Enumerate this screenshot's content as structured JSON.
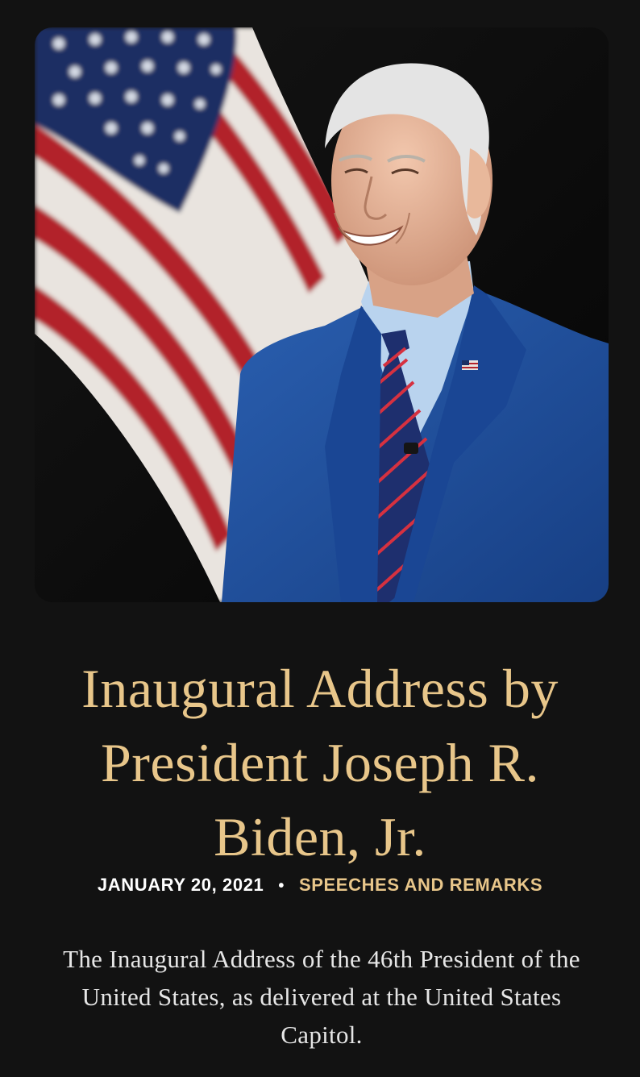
{
  "article": {
    "image": {
      "alt": "Portrait of President Joseph R. Biden, Jr. in front of an American flag",
      "colors": {
        "background": "#0b0b0b",
        "suit": "#1f4e9a",
        "shirt": "#b9d3ee",
        "flag_red": "#b2242c",
        "flag_blue": "#1b2f63"
      }
    },
    "title": "Inaugural Address by President Joseph R. Biden, Jr.",
    "date": "JANUARY 20, 2021",
    "separator": "•",
    "category": "SPEECHES AND REMARKS",
    "summary": "The Inaugural Address of the 46th President of the United States, as delivered at the United States Capitol."
  },
  "colors": {
    "page_background": "#121212",
    "accent_gold": "#e8c68a",
    "body_text": "#e6e6e6"
  }
}
